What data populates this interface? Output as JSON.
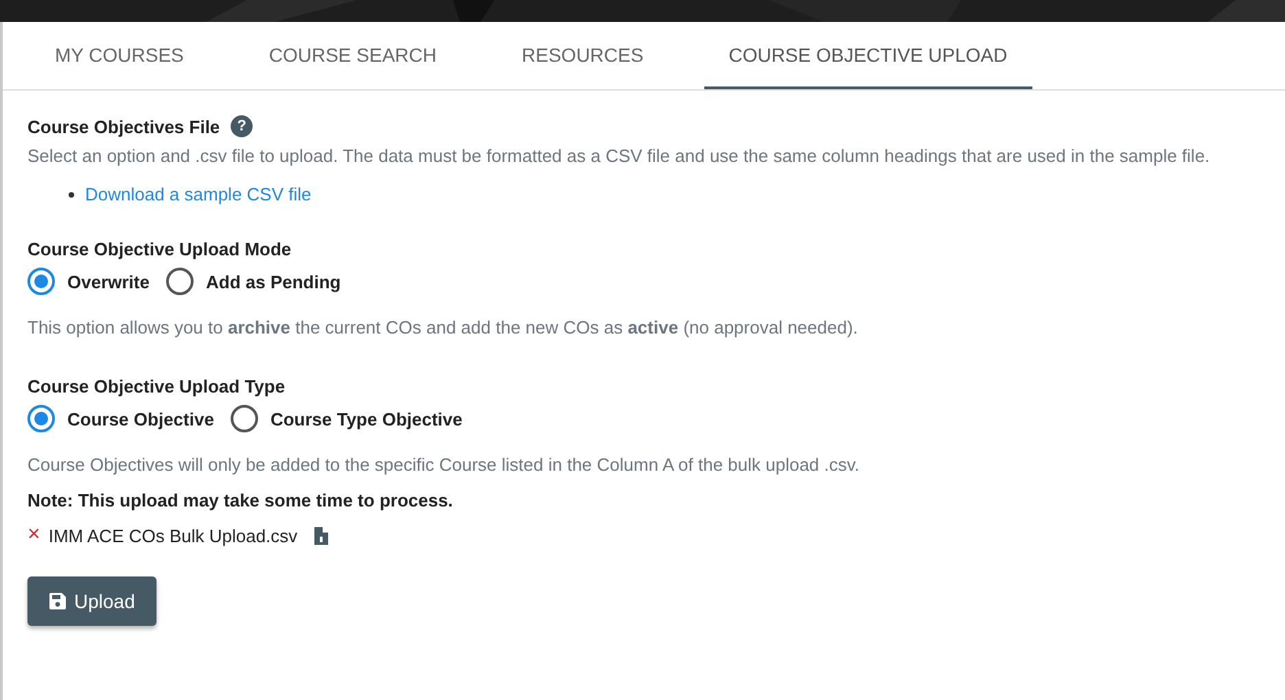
{
  "tabs": [
    {
      "label": "MY COURSES",
      "selected": false
    },
    {
      "label": "COURSE SEARCH",
      "selected": false
    },
    {
      "label": "RESOURCES",
      "selected": false
    },
    {
      "label": "COURSE OBJECTIVE UPLOAD",
      "selected": true
    }
  ],
  "file_section": {
    "title": "Course Objectives File",
    "help_icon": "?",
    "description": "Select an option and .csv file to upload. The data must be formatted as a CSV file and use the same column headings that are used in the sample file.",
    "link": "Download a sample CSV file"
  },
  "upload_mode": {
    "title": "Course Objective Upload Mode",
    "options": [
      {
        "label": "Overwrite",
        "selected": true
      },
      {
        "label": "Add as Pending",
        "selected": false
      }
    ],
    "info": "This option allows you to **archive** the current COs and add the new COs as **active** (no approval needed)."
  },
  "upload_type": {
    "title": "Course Objective Upload Type",
    "options": [
      {
        "label": "Course Objective",
        "selected": true
      },
      {
        "label": "Course Type Objective",
        "selected": false
      }
    ],
    "info": "Course Objectives will only be added to the specific Course listed in the Column A of the bulk upload .csv."
  },
  "note": "Note: This upload may take some time to process.",
  "file": {
    "remove": "×",
    "name": "IMM ACE COs Bulk Upload.csv"
  },
  "upload_button": "Upload"
}
